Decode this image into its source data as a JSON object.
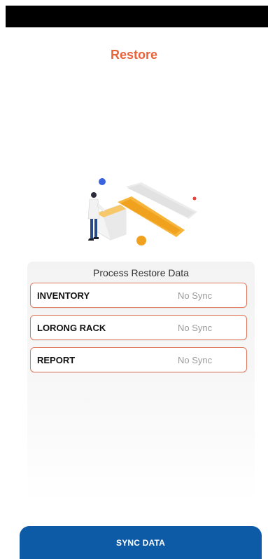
{
  "header": {
    "title": "Restore"
  },
  "panel": {
    "title": "Process Restore Data",
    "items": [
      {
        "label": "INVENTORY",
        "status": "No Sync"
      },
      {
        "label": "LORONG RACK",
        "status": "No Sync"
      },
      {
        "label": "REPORT",
        "status": "No Sync"
      }
    ]
  },
  "actions": {
    "sync_label": "SYNC DATA"
  },
  "colors": {
    "accent": "#e8623a",
    "row_border": "#e07a5f",
    "primary_button": "#0d5aa7",
    "status_text": "#9a9a9a"
  },
  "icons": {
    "illustration": "data-sync-illustration"
  }
}
